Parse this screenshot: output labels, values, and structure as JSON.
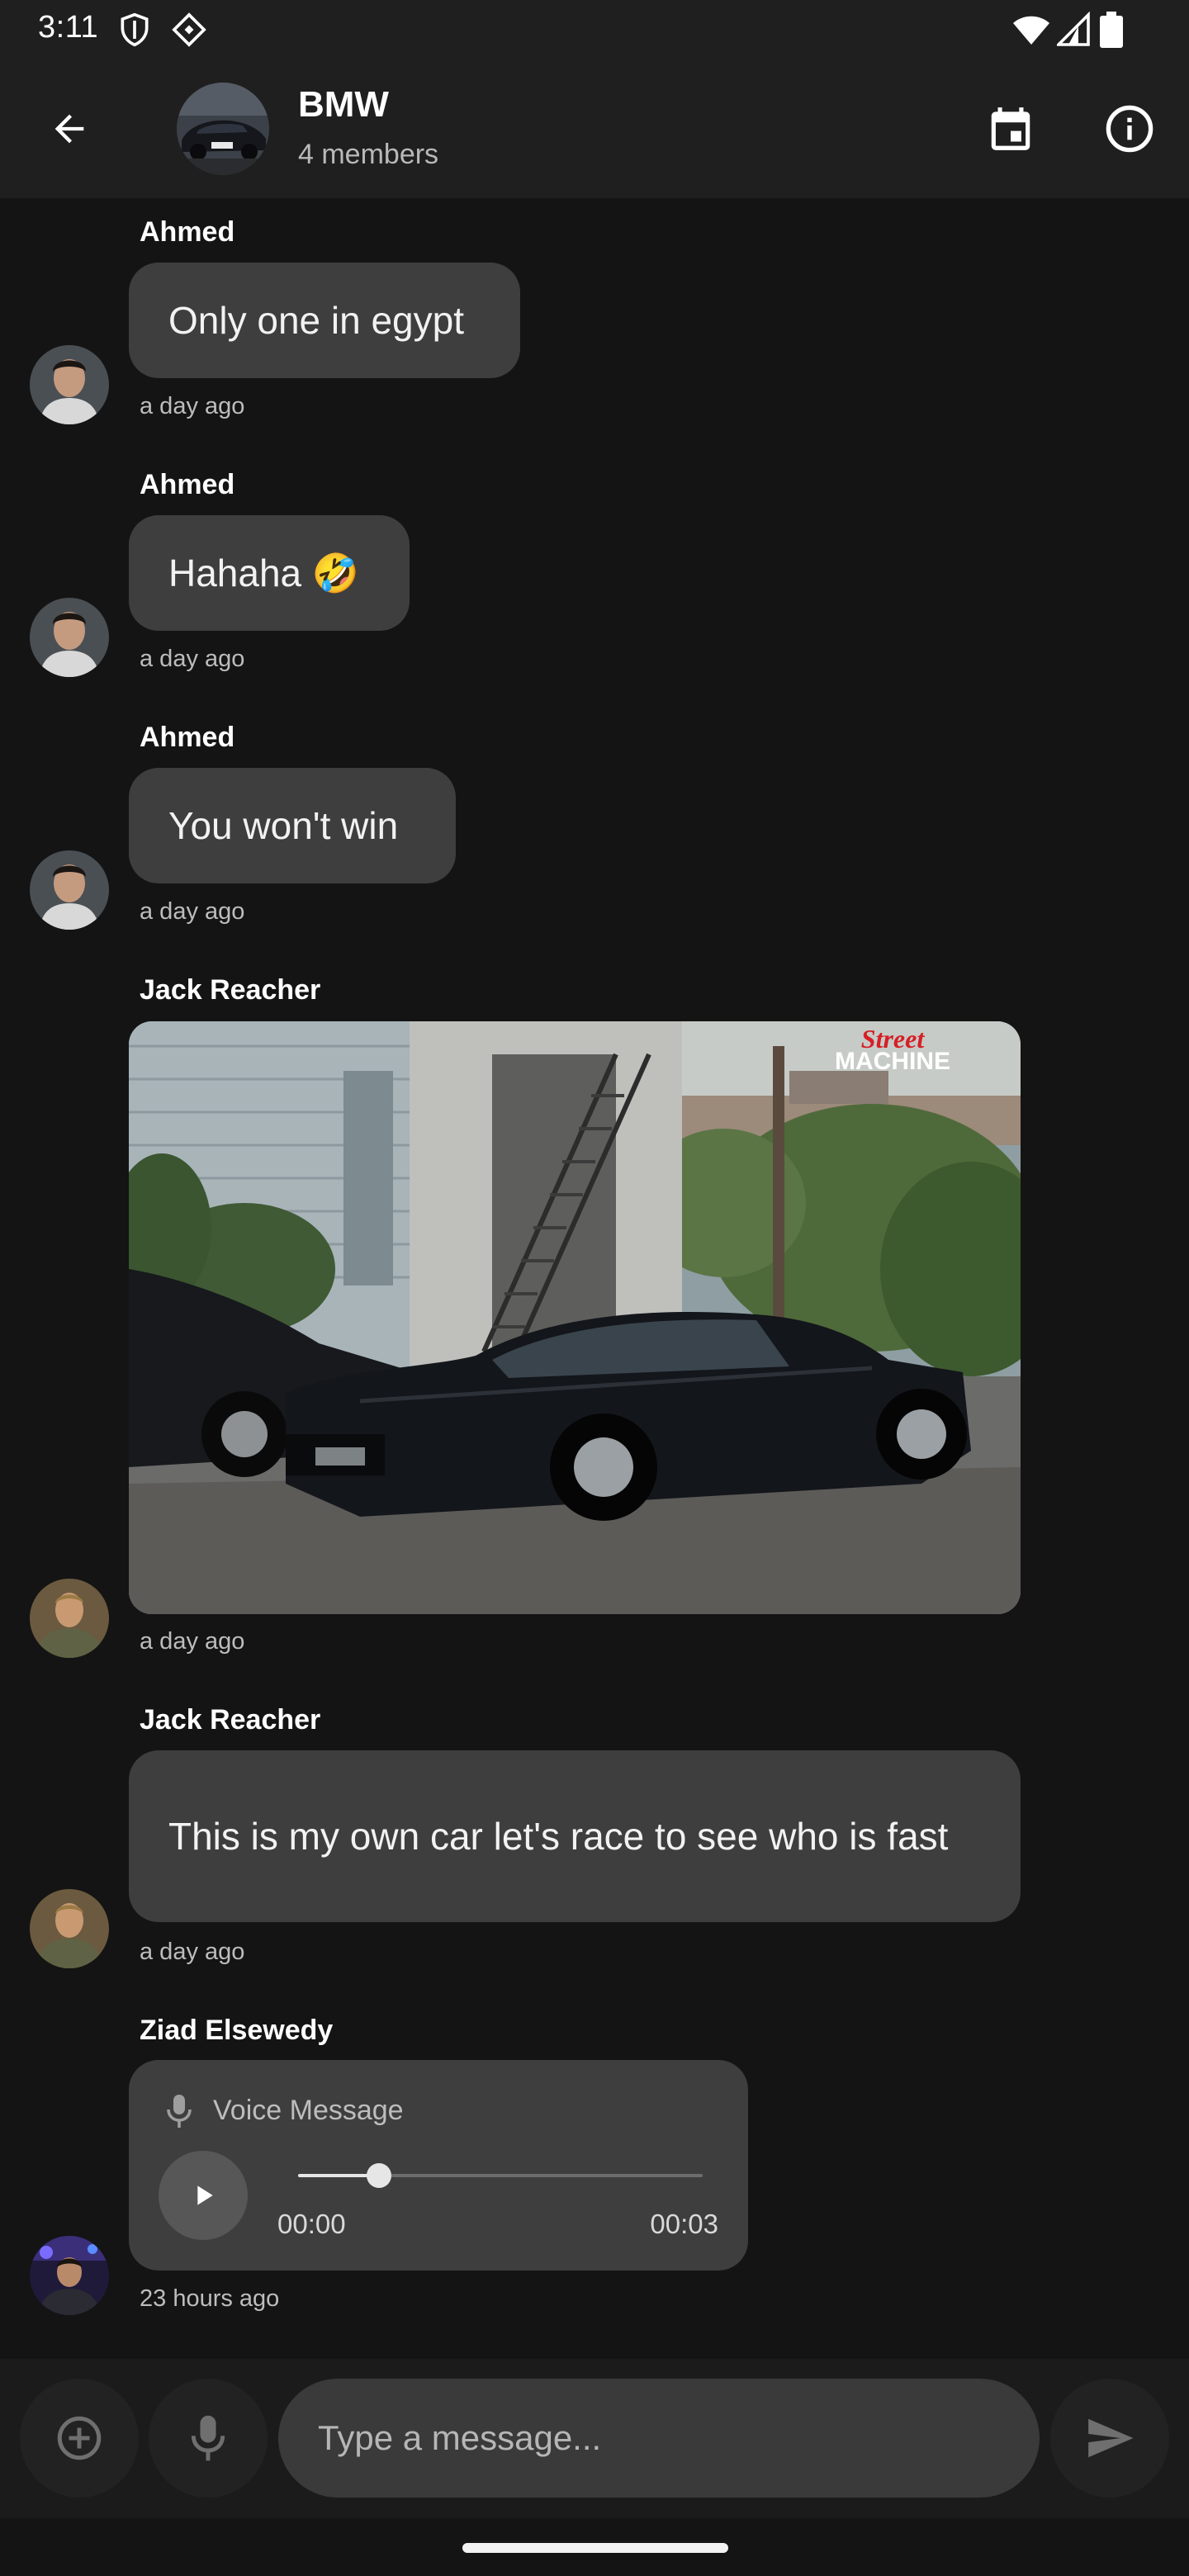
{
  "status_bar": {
    "time": "3:11",
    "icons": [
      "shield-icon",
      "vpn-icon",
      "wifi-icon",
      "signal-icon",
      "battery-icon"
    ]
  },
  "header": {
    "title": "BMW",
    "subtitle": "4 members",
    "icons": [
      "back-arrow-icon",
      "calendar-icon",
      "info-icon"
    ]
  },
  "messages": [
    {
      "sender": "Ahmed",
      "text": "Only one in egypt",
      "time": "a day ago"
    },
    {
      "sender": "Ahmed",
      "text": "Hahaha 🤣",
      "time": "a day ago"
    },
    {
      "sender": "Ahmed",
      "text": "You won't win",
      "time": "a day ago"
    },
    {
      "sender": "Jack Reacher",
      "type": "image",
      "image_overlay_text": "Street MACHINE",
      "image_overlay_top": "Street",
      "image_overlay_bottom": "MACHINE",
      "time": "a day ago"
    },
    {
      "sender": "Jack Reacher",
      "text": "This is my own car let's race to see who is fast",
      "time": "a day ago"
    },
    {
      "sender": "Ziad Elsewedy",
      "type": "voice",
      "label": "Voice Message",
      "position": "00:00",
      "duration": "00:03",
      "progress": 0.2,
      "time": "23 hours ago"
    }
  ],
  "composer": {
    "placeholder": "Type a message...",
    "icons": [
      "add-circle-icon",
      "microphone-icon",
      "send-icon"
    ]
  },
  "colors": {
    "background": "#141414",
    "app_bar": "#1f1f1f",
    "bubble": "#3e3e3e",
    "input": "#3a3a3a"
  }
}
